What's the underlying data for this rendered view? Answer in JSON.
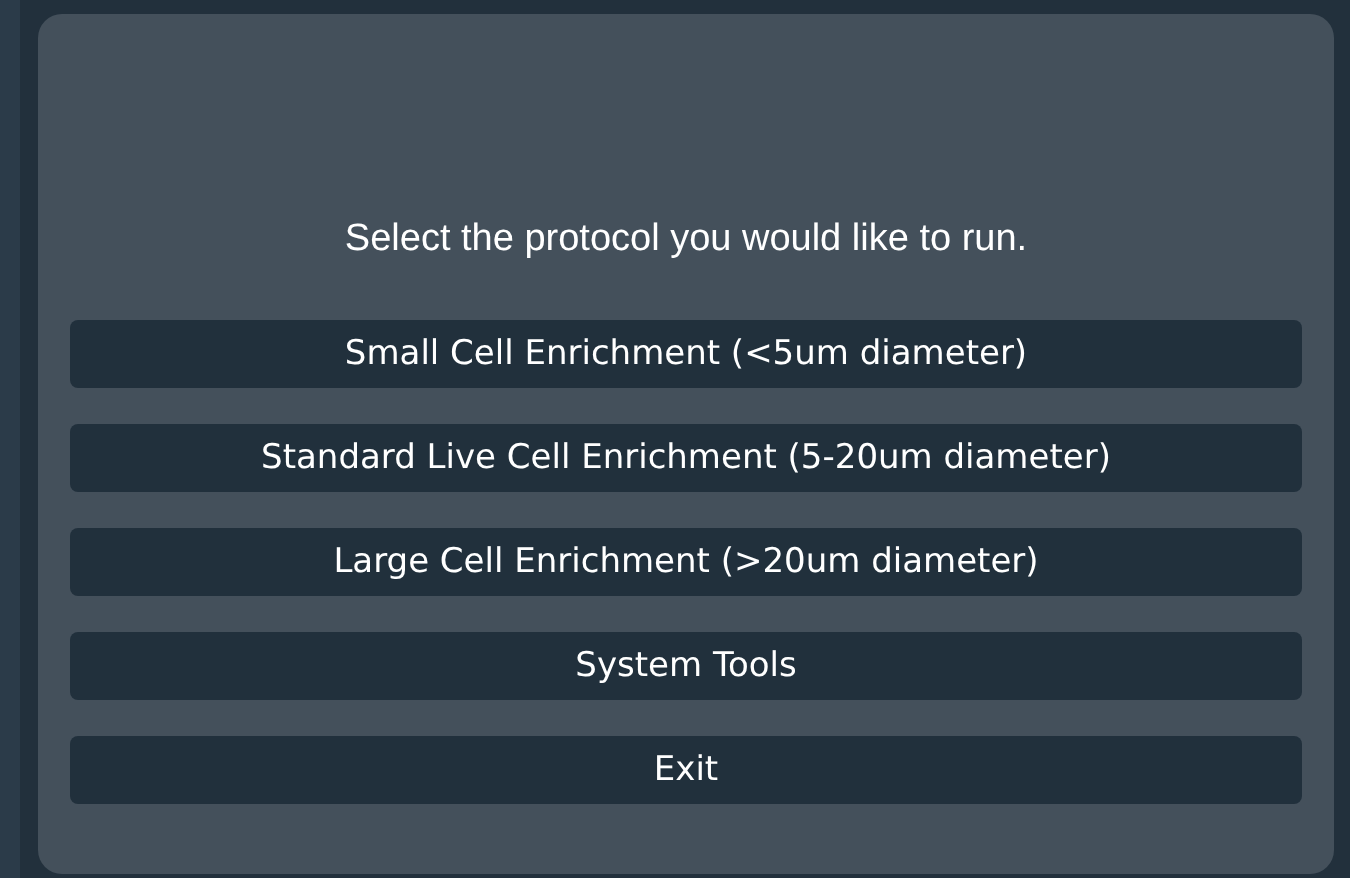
{
  "prompt": "Select the protocol you would like to run.",
  "buttons": [
    {
      "label": "Small Cell Enrichment (<5um diameter)"
    },
    {
      "label": "Standard Live Cell Enrichment (5-20um diameter)"
    },
    {
      "label": "Large Cell Enrichment (>20um diameter)"
    },
    {
      "label": "System Tools"
    },
    {
      "label": "Exit"
    }
  ]
}
